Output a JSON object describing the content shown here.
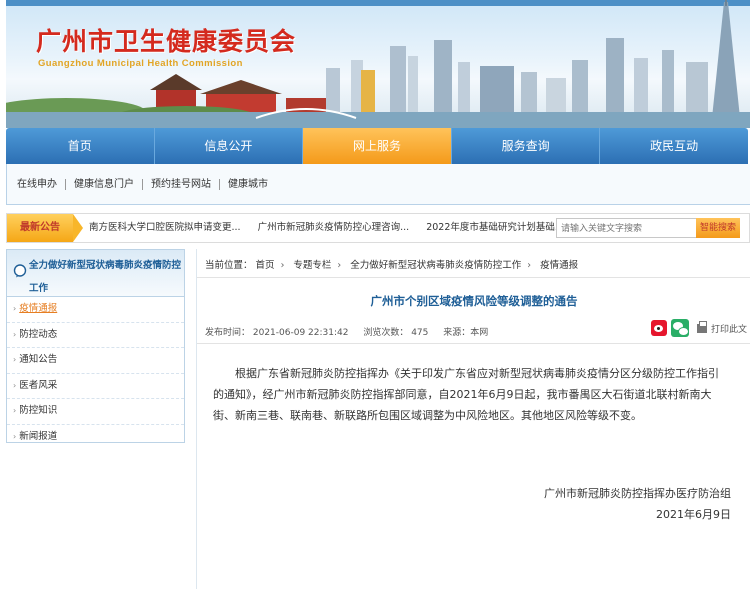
{
  "site": {
    "title": "广州市卫生健康委员会",
    "subtitle": "Guangzhou Municipal Health Commission"
  },
  "nav": {
    "items": [
      "首页",
      "信息公开",
      "网上服务",
      "服务查询",
      "政民互动"
    ],
    "active_index": 2
  },
  "subnav": {
    "items": [
      "在线申办",
      "健康信息门户",
      "预约挂号网站",
      "健康城市"
    ]
  },
  "announcements": {
    "label": "最新公告",
    "items": [
      "南方医科大学口腔医院拟申请变更...",
      "广州市新冠肺炎疫情防控心理咨询...",
      "2022年度市基础研究计划基础..."
    ]
  },
  "search": {
    "placeholder": "请输入关键文字搜索",
    "button_label": "智能搜索"
  },
  "sidebar": {
    "title_line1": "全力做好新型冠状病毒肺炎疫情防控",
    "title_line2": "工作",
    "items": [
      {
        "label": "疫情通报",
        "active": true
      },
      {
        "label": "防控动态",
        "active": false
      },
      {
        "label": "通知公告",
        "active": false
      },
      {
        "label": "医者风采",
        "active": false
      },
      {
        "label": "防控知识",
        "active": false
      },
      {
        "label": "新闻报道",
        "active": false
      }
    ]
  },
  "breadcrumb": {
    "prefix": "当前位置：",
    "items": [
      "首页",
      "专题专栏",
      "全力做好新型冠状病毒肺炎疫情防控工作",
      "疫情通报"
    ]
  },
  "article": {
    "title": "广州市个别区域疫情风险等级调整的通告",
    "publish_time": "发布时间： 2021-06-09 22:31:42",
    "views": "浏览次数： 475",
    "source": "来源：本网",
    "print_label": "打印此文",
    "body": "根据广东省新冠肺炎防控指挥办《关于印发广东省应对新型冠状病毒肺炎疫情分区分级防控工作指引的通知》，经广州市新冠肺炎防控指挥部同意，自2021年6月9日起，我市番禺区大石街道北联村新南大街、新南三巷、联南巷、新联路所包围区域调整为中风险地区。其他地区风险等级不变。",
    "signature": "广州市新冠肺炎防控指挥办医疗防治组",
    "date": "2021年6月9日"
  },
  "icons": {
    "share": [
      "weibo-icon",
      "wechat-icon"
    ],
    "print": "print-icon",
    "sidebar_head": "chat-bubble-icon"
  },
  "colors": {
    "nav_blue": "#2c6fb3",
    "nav_active": "#f49a1a",
    "title_red": "#d42a1e",
    "link_blue": "#1f5f97",
    "active_orange": "#e67e22"
  }
}
